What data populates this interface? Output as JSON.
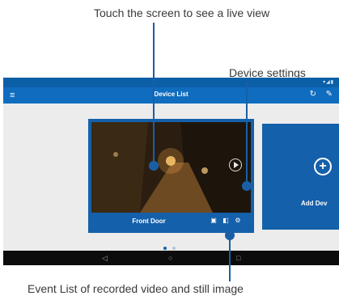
{
  "callouts": {
    "live_view": "Touch the screen to see a live view",
    "device_settings": "Device settings",
    "event_list": "Event List of recorded video and still image"
  },
  "status_bar": {
    "icons": "▾◢▮"
  },
  "app_bar": {
    "title": "Device List",
    "menu_icon": "≡",
    "refresh_icon": "↻",
    "edit_icon": "✎"
  },
  "device_card": {
    "name": "Front Door",
    "video_icon": "▣",
    "events_icon": "◧",
    "settings_icon": "⚙"
  },
  "add_device": {
    "label": "Add Dev",
    "plus": "+"
  },
  "nav": {
    "back": "◁",
    "home": "○",
    "recent": "□"
  },
  "colors": {
    "accent": "#0f6cbf",
    "card": "#1560aa",
    "leader": "#1a5fa6"
  }
}
